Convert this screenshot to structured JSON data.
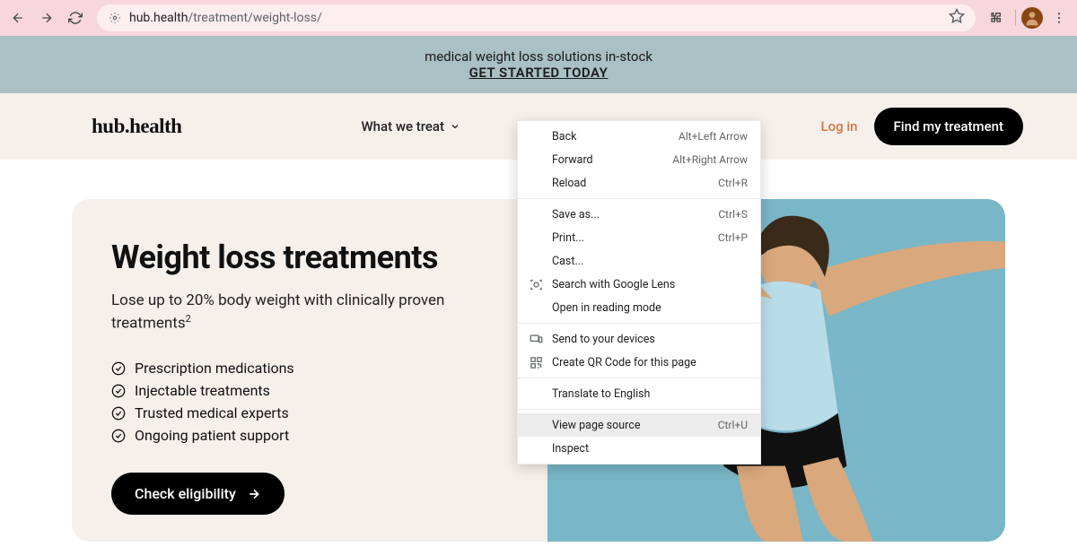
{
  "browser": {
    "url_host": "hub.health",
    "url_path": "/treatment/weight-loss/"
  },
  "promo": {
    "text": "medical weight loss solutions in-stock",
    "cta": "GET STARTED TODAY"
  },
  "header": {
    "logo": "hub.health",
    "nav_item": "What we treat",
    "login": "Log in",
    "cta": "Find my treatment"
  },
  "hero": {
    "title": "Weight loss treatments",
    "subtitle": "Lose up to 20% body weight with clinically proven treatments",
    "subtitle_sup": "2",
    "checklist": [
      "Prescription medications",
      "Injectable treatments",
      "Trusted medical experts",
      "Ongoing patient support"
    ],
    "cta": "Check eligibility"
  },
  "context_menu": {
    "groups": [
      [
        {
          "label": "Back",
          "shortcut": "Alt+Left Arrow",
          "icon": ""
        },
        {
          "label": "Forward",
          "shortcut": "Alt+Right Arrow",
          "icon": ""
        },
        {
          "label": "Reload",
          "shortcut": "Ctrl+R",
          "icon": ""
        }
      ],
      [
        {
          "label": "Save as...",
          "shortcut": "Ctrl+S",
          "icon": ""
        },
        {
          "label": "Print...",
          "shortcut": "Ctrl+P",
          "icon": ""
        },
        {
          "label": "Cast...",
          "shortcut": "",
          "icon": ""
        },
        {
          "label": "Search with Google Lens",
          "shortcut": "",
          "icon": "lens"
        },
        {
          "label": "Open in reading mode",
          "shortcut": "",
          "icon": ""
        }
      ],
      [
        {
          "label": "Send to your devices",
          "shortcut": "",
          "icon": "devices"
        },
        {
          "label": "Create QR Code for this page",
          "shortcut": "",
          "icon": "qr"
        }
      ],
      [
        {
          "label": "Translate to English",
          "shortcut": "",
          "icon": ""
        }
      ],
      [
        {
          "label": "View page source",
          "shortcut": "Ctrl+U",
          "icon": "",
          "hover": true
        },
        {
          "label": "Inspect",
          "shortcut": "",
          "icon": ""
        }
      ]
    ]
  }
}
